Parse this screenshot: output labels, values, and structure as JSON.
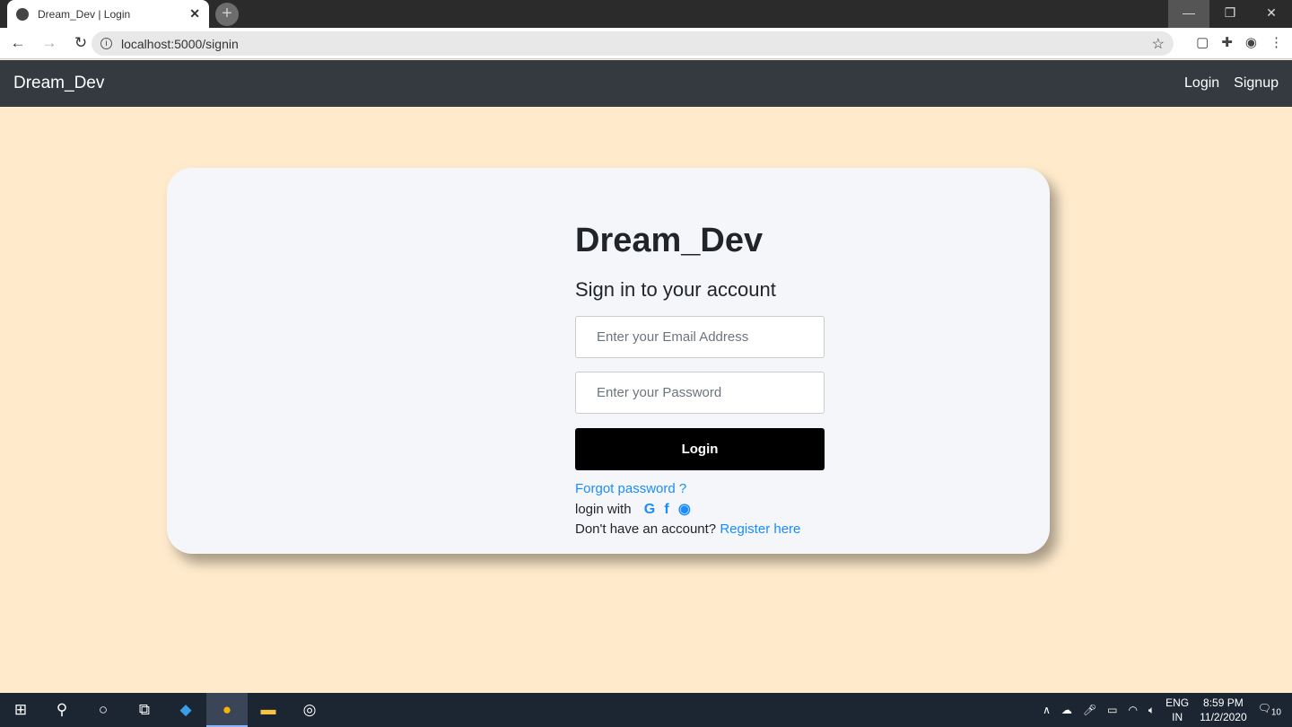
{
  "browser": {
    "tab_title": "Dream_Dev | Login",
    "url": "localhost:5000/signin"
  },
  "navbar": {
    "brand": "Dream_Dev",
    "links": [
      "Login",
      "Signup"
    ]
  },
  "form": {
    "title": "Dream_Dev",
    "subtitle": "Sign in to your account",
    "email_placeholder": "Enter your Email Address",
    "password_placeholder": "Enter your Password",
    "login_label": "Login",
    "forgot": "Forgot password ?",
    "login_with": "login with",
    "social": [
      "google-icon",
      "facebook-icon",
      "github-icon"
    ],
    "no_account": "Don't have an account?",
    "register": "Register here"
  },
  "taskbar": {
    "lang1": "ENG",
    "lang2": "IN",
    "time": "8:59 PM",
    "date": "11/2/2020",
    "notifications": "10"
  }
}
